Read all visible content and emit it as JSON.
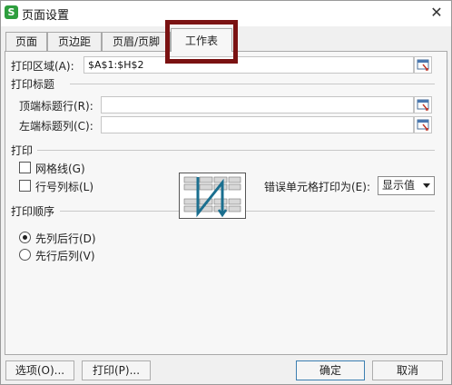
{
  "window": {
    "title": "页面设置",
    "icon": "S"
  },
  "tabs": [
    {
      "label": "页面"
    },
    {
      "label": "页边距"
    },
    {
      "label": "页眉/页脚"
    },
    {
      "label": "工作表"
    }
  ],
  "print_area": {
    "label": "打印区域(A):",
    "value": "$A$1:$H$2"
  },
  "print_titles": {
    "section": "打印标题",
    "top_rows_label": "顶端标题行(R):",
    "top_rows_value": "",
    "left_cols_label": "左端标题列(C):",
    "left_cols_value": ""
  },
  "print": {
    "section": "打印",
    "gridlines_label": "网格线(G)",
    "gridlines_checked": false,
    "row_col_headers_label": "行号列标(L)",
    "row_col_headers_checked": false,
    "cell_errors_label": "错误单元格打印为(E):",
    "cell_errors_value": "显示值"
  },
  "page_order": {
    "section": "打印顺序",
    "down_then_over_label": "先列后行(D)",
    "over_then_down_label": "先行后列(V)",
    "selected": "down_then_over"
  },
  "buttons": {
    "options": "选项(O)...",
    "print": "打印(P)...",
    "ok": "确定",
    "cancel": "取消"
  },
  "colors": {
    "highlight": "#7a1212",
    "accent": "#2e9e3e",
    "preview_arrow": "#1b6f8f"
  }
}
